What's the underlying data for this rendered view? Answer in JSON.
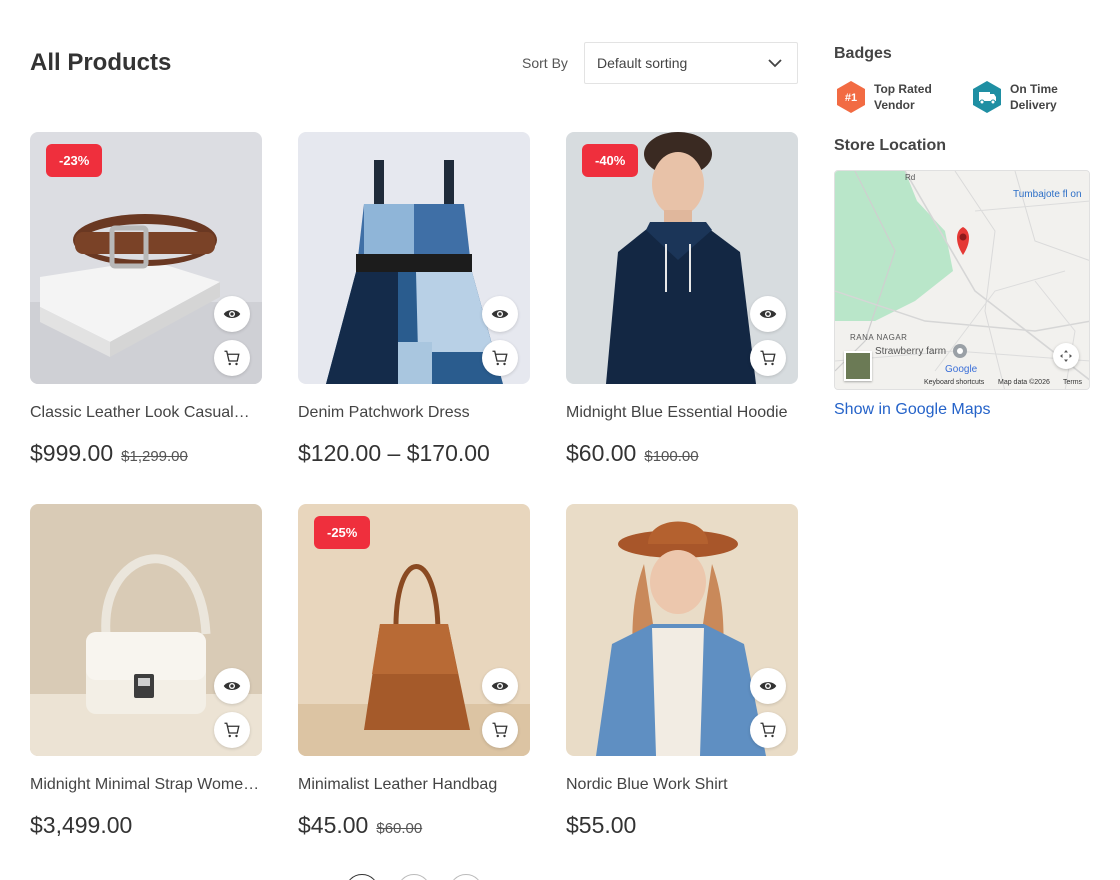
{
  "header": {
    "title": "All Products",
    "sort_label": "Sort By",
    "sort_value": "Default sorting"
  },
  "products": [
    {
      "title": "Classic Leather Look Casual…",
      "discount": "-23%",
      "price": "$999.00",
      "old_price": "$1,299.00"
    },
    {
      "title": "Denim Patchwork Dress",
      "discount": "",
      "price": "$120.00 – $170.00",
      "old_price": ""
    },
    {
      "title": "Midnight Blue Essential Hoodie",
      "discount": "-40%",
      "price": "$60.00",
      "old_price": "$100.00"
    },
    {
      "title": "Midnight Minimal Strap Wome…",
      "discount": "",
      "price": "$3,499.00",
      "old_price": ""
    },
    {
      "title": "Minimalist Leather Handbag",
      "discount": "-25%",
      "price": "$45.00",
      "old_price": "$60.00"
    },
    {
      "title": "Nordic Blue Work Shirt",
      "discount": "",
      "price": "$55.00",
      "old_price": ""
    }
  ],
  "sidebar": {
    "badges_heading": "Badges",
    "badges": [
      {
        "label": "Top Rated Vendor",
        "icon_text": "#1",
        "color": "#f26b43",
        "icon": "rank-icon"
      },
      {
        "label": "On Time Delivery",
        "icon_text": "",
        "color": "#1f8fa3",
        "icon": "truck-icon"
      }
    ],
    "store_heading": "Store Location",
    "map": {
      "place_label": "Tumbajote fl on",
      "area_label": "RANA NAGAR",
      "poi_label": "Strawberry farm",
      "google_label": "Google",
      "shortcuts": "Keyboard shortcuts",
      "map_data": "Map data ©2026",
      "terms": "Terms",
      "road_label": "Rd"
    },
    "map_link": "Show in Google Maps"
  },
  "colors": {
    "sale_badge": "#ef2f3d",
    "link": "#2563c9"
  }
}
